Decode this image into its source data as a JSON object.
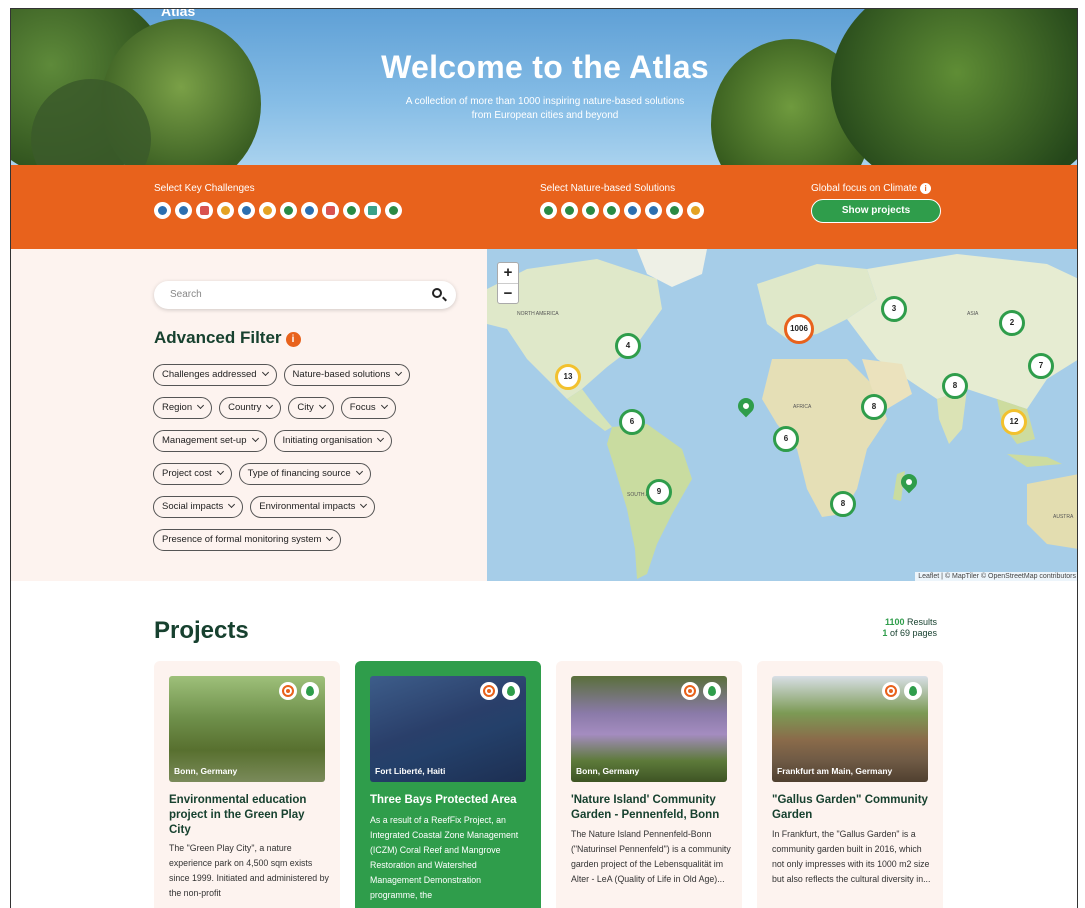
{
  "hero": {
    "logo_text": "Atlas",
    "title": "Welcome to the Atlas",
    "subtitle_line1": "A collection of more than 1000 inspiring nature-based solutions",
    "subtitle_line2": "from European cities and beyond"
  },
  "orange_bar": {
    "key_challenges_label": "Select Key Challenges",
    "nbs_label": "Select Nature-based Solutions",
    "climate_label": "Global focus on Climate",
    "show_projects_label": "Show projects",
    "challenge_icons": [
      "cloud-icon",
      "water-drop-icon",
      "star-icon",
      "heat-icon",
      "globe-icon",
      "landscape-icon",
      "recycle-icon",
      "people-icon",
      "heart-icon",
      "growth-chart-icon",
      "building-icon",
      "tree-recycle-icon"
    ],
    "nbs_icons": [
      "house-icon",
      "plant-icon",
      "garden-icon",
      "park-icon",
      "leaf-icon",
      "water-waves-icon",
      "building-green-icon",
      "urban-icon"
    ],
    "colors": {
      "orange": "#e8621c",
      "green": "#2f9d4b",
      "dark_green": "#17412f"
    }
  },
  "filter": {
    "search_placeholder": "Search",
    "advanced_title": "Advanced Filter",
    "chips": [
      "Challenges addressed",
      "Nature-based solutions",
      "Region",
      "Country",
      "City",
      "Focus",
      "Management set-up",
      "Initiating organisation",
      "Project cost",
      "Type of financing source",
      "Social impacts",
      "Environmental impacts",
      "Presence of formal monitoring system"
    ]
  },
  "map": {
    "zoom_in": "+",
    "zoom_out": "−",
    "labels": {
      "north_america": "NORTH AMERICA",
      "africa": "AFRICA",
      "asia": "ASIA",
      "south_america": "SOUTH A",
      "australia": "AUSTRA"
    },
    "clusters": [
      "4",
      "1006",
      "3",
      "2",
      "7",
      "13",
      "8",
      "8",
      "12",
      "6",
      "6",
      "9",
      "8"
    ],
    "attribution": "Leaflet | © MapTiler © OpenStreetMap contributors"
  },
  "projects": {
    "title": "Projects",
    "results_count": "1100",
    "results_label": "Results",
    "page_current": "1",
    "page_label": "of 69 pages",
    "cards": [
      {
        "location": "Bonn, Germany",
        "title": "Environmental education project in the Green Play City",
        "text": "The \"Green Play City\", a nature experience park on 4,500 sqm exists since 1999. Initiated and administered by the non-profit"
      },
      {
        "location": "Fort Liberté, Haiti",
        "title": "Three Bays Protected Area",
        "text": "As a result of a ReefFix Project, an Integrated Coastal Zone Management (ICZM) Coral Reef and Mangrove Restoration and Watershed Management Demonstration programme, the"
      },
      {
        "location": "Bonn, Germany",
        "title": "'Nature Island' Community Garden - Pennenfeld, Bonn",
        "text": "The Nature Island Pennenfeld-Bonn (\"Naturinsel Pennenfeld\") is a community garden project of the Lebensqualität im Alter - LeA (Quality of Life in Old Age)..."
      },
      {
        "location": "Frankfurt am Main, Germany",
        "title": "\"Gallus Garden\" Community Garden",
        "text": "In Frankfurt, the \"Gallus Garden\" is a community garden built in 2016, which not only impresses with its 1000 m2 size but also reflects the cultural diversity in..."
      }
    ]
  }
}
